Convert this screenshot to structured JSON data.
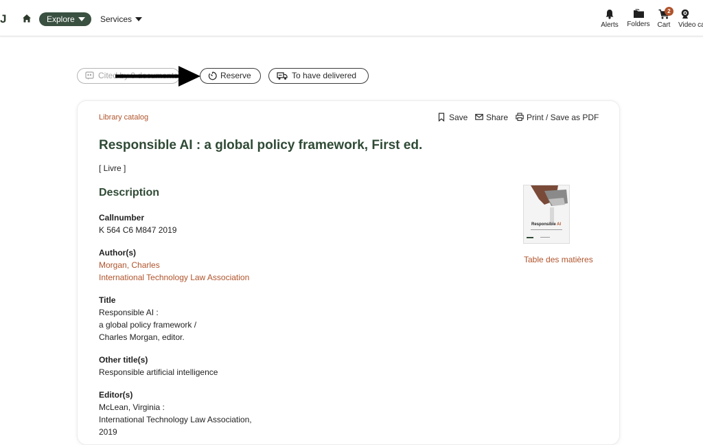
{
  "nav": {
    "logo_fragment": "J",
    "explore_label": "Explore",
    "services_label": "Services",
    "alerts_label": "Alerts",
    "folders_label": "Folders",
    "cart_label": "Cart",
    "cart_count": "2",
    "video_label": "Video ca"
  },
  "actions": {
    "cited_label": "Cited by 0 documents",
    "reserve_label": "Reserve",
    "deliver_label": "To have delivered"
  },
  "record": {
    "source": "Library catalog",
    "save_label": "Save",
    "share_label": "Share",
    "print_label": "Print / Save as PDF",
    "title": "Responsible AI : a global policy framework, First ed.",
    "doc_type": "[ Livre ]",
    "description_heading": "Description",
    "callnumber_label": "Callnumber",
    "callnumber_value": "K 564 C6 M847 2019",
    "authors_label": "Author(s)",
    "authors": [
      "Morgan, Charles",
      "International Technology Law Association"
    ],
    "title_label": "Title",
    "title_lines": [
      "Responsible AI :",
      "a global policy framework /",
      "Charles Morgan, editor."
    ],
    "other_titles_label": "Other title(s)",
    "other_title_value": "Responsible artificial intelligence",
    "editors_label": "Editor(s)",
    "editor_lines": [
      "McLean, Virginia :",
      "International Technology Law Association,",
      "2019"
    ],
    "cover_title_line1": "Responsible",
    "cover_title_accent": "AI",
    "toc_label": "Table des matières"
  },
  "colors": {
    "primary_green": "#3a5040",
    "heading_green": "#2f4a35",
    "link_rust": "#b0532b"
  }
}
